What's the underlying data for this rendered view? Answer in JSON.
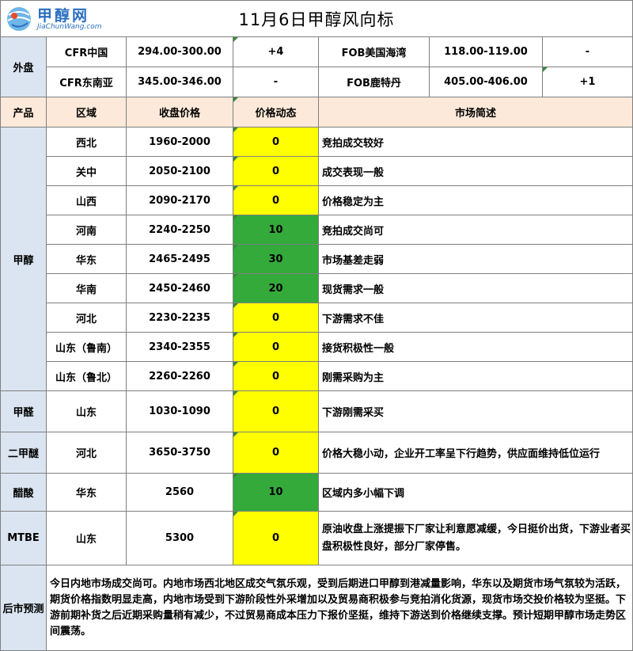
{
  "logo": {
    "name": "甲醇网",
    "site": "JiaChunWang.com"
  },
  "title": "11月6日甲醇风向标",
  "outer": {
    "label": "外盘",
    "rows": [
      {
        "a_name": "CFR中国",
        "a_price": "294.00-300.00",
        "a_change": "+4",
        "b_name": "FOB美国海湾",
        "b_price": "118.00-119.00",
        "b_change": "-"
      },
      {
        "a_name": "CFR东南亚",
        "a_price": "345.00-346.00",
        "a_change": "-",
        "b_name": "FOB鹿特丹",
        "b_price": "405.00-406.00",
        "b_change": "+1"
      }
    ]
  },
  "headers": {
    "product": "产品",
    "region": "区域",
    "price": "收盘价格",
    "trend": "价格动态",
    "desc": "市场简述"
  },
  "methanol": {
    "label": "甲醇",
    "rows": [
      {
        "region": "西北",
        "price": "1960-2000",
        "change": "0",
        "desc": "竞拍成交较好",
        "color": "#ffff00"
      },
      {
        "region": "关中",
        "price": "2050-2100",
        "change": "0",
        "desc": "成交表现一般",
        "color": "#ffff00"
      },
      {
        "region": "山西",
        "price": "2090-2170",
        "change": "0",
        "desc": "价格稳定为主",
        "color": "#ffff00"
      },
      {
        "region": "河南",
        "price": "2240-2250",
        "change": "10",
        "desc": "竞拍成交尚可",
        "color": "#33aa3a"
      },
      {
        "region": "华东",
        "price": "2465-2495",
        "change": "30",
        "desc": "市场基差走弱",
        "color": "#33aa3a"
      },
      {
        "region": "华南",
        "price": "2450-2460",
        "change": "20",
        "desc": "现货需求一般",
        "color": "#33aa3a"
      },
      {
        "region": "河北",
        "price": "2230-2235",
        "change": "0",
        "desc": "下游需求不佳",
        "color": "#ffff00"
      },
      {
        "region": "山东（鲁南）",
        "price": "2340-2355",
        "change": "0",
        "desc": "接货积极性一般",
        "color": "#ffff00"
      },
      {
        "region": "山东（鲁北）",
        "price": "2260-2260",
        "change": "0",
        "desc": "刚需采购为主",
        "color": "#ffff00"
      }
    ]
  },
  "formaldehyde": {
    "label": "甲醛",
    "region": "山东",
    "price": "1030-1090",
    "change": "0",
    "desc": "下游刚需采买",
    "color": "#ffff00"
  },
  "dme": {
    "label": "二甲醚",
    "region": "河北",
    "price": "3650-3750",
    "change": "0",
    "desc": "价格大稳小动，企业开工率呈下行趋势，供应面维持低位运行",
    "color": "#ffff00"
  },
  "acetic": {
    "label": "醋酸",
    "region": "华东",
    "price": "2560",
    "change": "10",
    "desc": "区域内多小幅下调",
    "color": "#33aa3a"
  },
  "mtbe": {
    "label": "MTBE",
    "region": "山东",
    "price": "5300",
    "change": "0",
    "desc": "原油收盘上涨提振下厂家让利意愿减缓，今日挺价出货，下游业者买盘积极性良好，部分厂家停售。",
    "color": "#ffff00"
  },
  "forecast": {
    "label": "后市预测",
    "text": "今日内地市场成交尚可。内地市场西北地区成交气氛乐观，受到后期进口甲醇到港减量影响，华东以及期货市场气氛较为活跃，期货价格指数明显走高，内地市场受到下游阶段性外采增加以及贸易商积极参与竞拍消化货源，现货市场交投价格较为坚挺。下游前期补货之后近期采购量稍有减少，不过贸易商成本压力下报价坚挺，维持下游送到价格继续支撑。预计短期甲醇市场走势区间震荡。"
  }
}
